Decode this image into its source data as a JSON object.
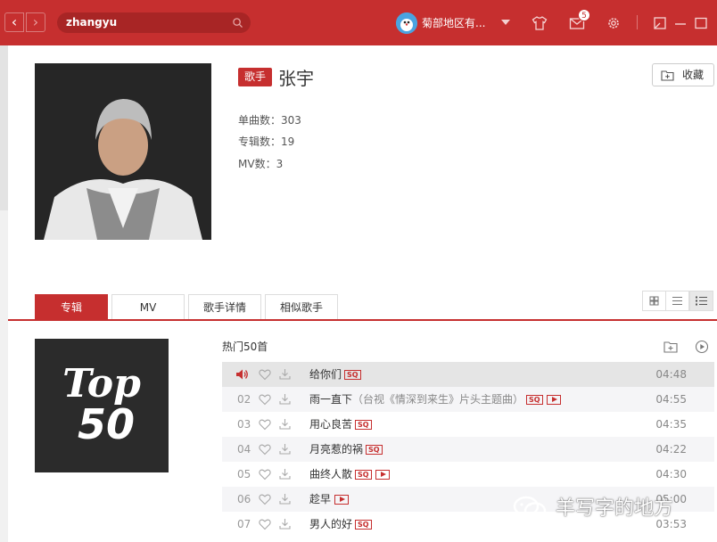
{
  "titlebar": {
    "search_value": "zhangyu",
    "user_name": "菊部地区有...",
    "message_count": "5",
    "colors": {
      "brand": "#c62f2f"
    }
  },
  "artist": {
    "tag": "歌手",
    "name": "张宇",
    "singles": "单曲数：303",
    "albums": "专辑数：19",
    "mvs": "MV数：3",
    "collect_label": "收藏"
  },
  "tabs": [
    {
      "label": "专辑",
      "active": true
    },
    {
      "label": "MV",
      "active": false
    },
    {
      "label": "歌手详情",
      "active": false
    },
    {
      "label": "相似歌手",
      "active": false
    }
  ],
  "cover": {
    "line1": "Top",
    "line2": "50"
  },
  "section": {
    "title": "热门50首"
  },
  "songs": [
    {
      "index": "",
      "title": "给你们",
      "subtitle": "",
      "sq": "SQ",
      "mv": false,
      "duration": "04:48",
      "playing": true
    },
    {
      "index": "02",
      "title": "雨一直下",
      "subtitle": "（台视《情深到来生》片头主题曲）",
      "sq": "SQ",
      "mv": true,
      "duration": "04:55",
      "playing": false
    },
    {
      "index": "03",
      "title": "用心良苦",
      "subtitle": "",
      "sq": "SQ",
      "mv": false,
      "duration": "04:35",
      "playing": false
    },
    {
      "index": "04",
      "title": "月亮惹的祸",
      "subtitle": "",
      "sq": "SQ",
      "mv": false,
      "duration": "04:22",
      "playing": false
    },
    {
      "index": "05",
      "title": "曲终人散",
      "subtitle": "",
      "sq": "SQ",
      "mv": true,
      "duration": "04:30",
      "playing": false
    },
    {
      "index": "06",
      "title": "趁早",
      "subtitle": "",
      "sq": "",
      "mv": true,
      "duration": "05:00",
      "playing": false
    },
    {
      "index": "07",
      "title": "男人的好",
      "subtitle": "",
      "sq": "SQ",
      "mv": false,
      "duration": "03:53",
      "playing": false
    }
  ],
  "watermark": {
    "text": "羊写字的地方"
  }
}
